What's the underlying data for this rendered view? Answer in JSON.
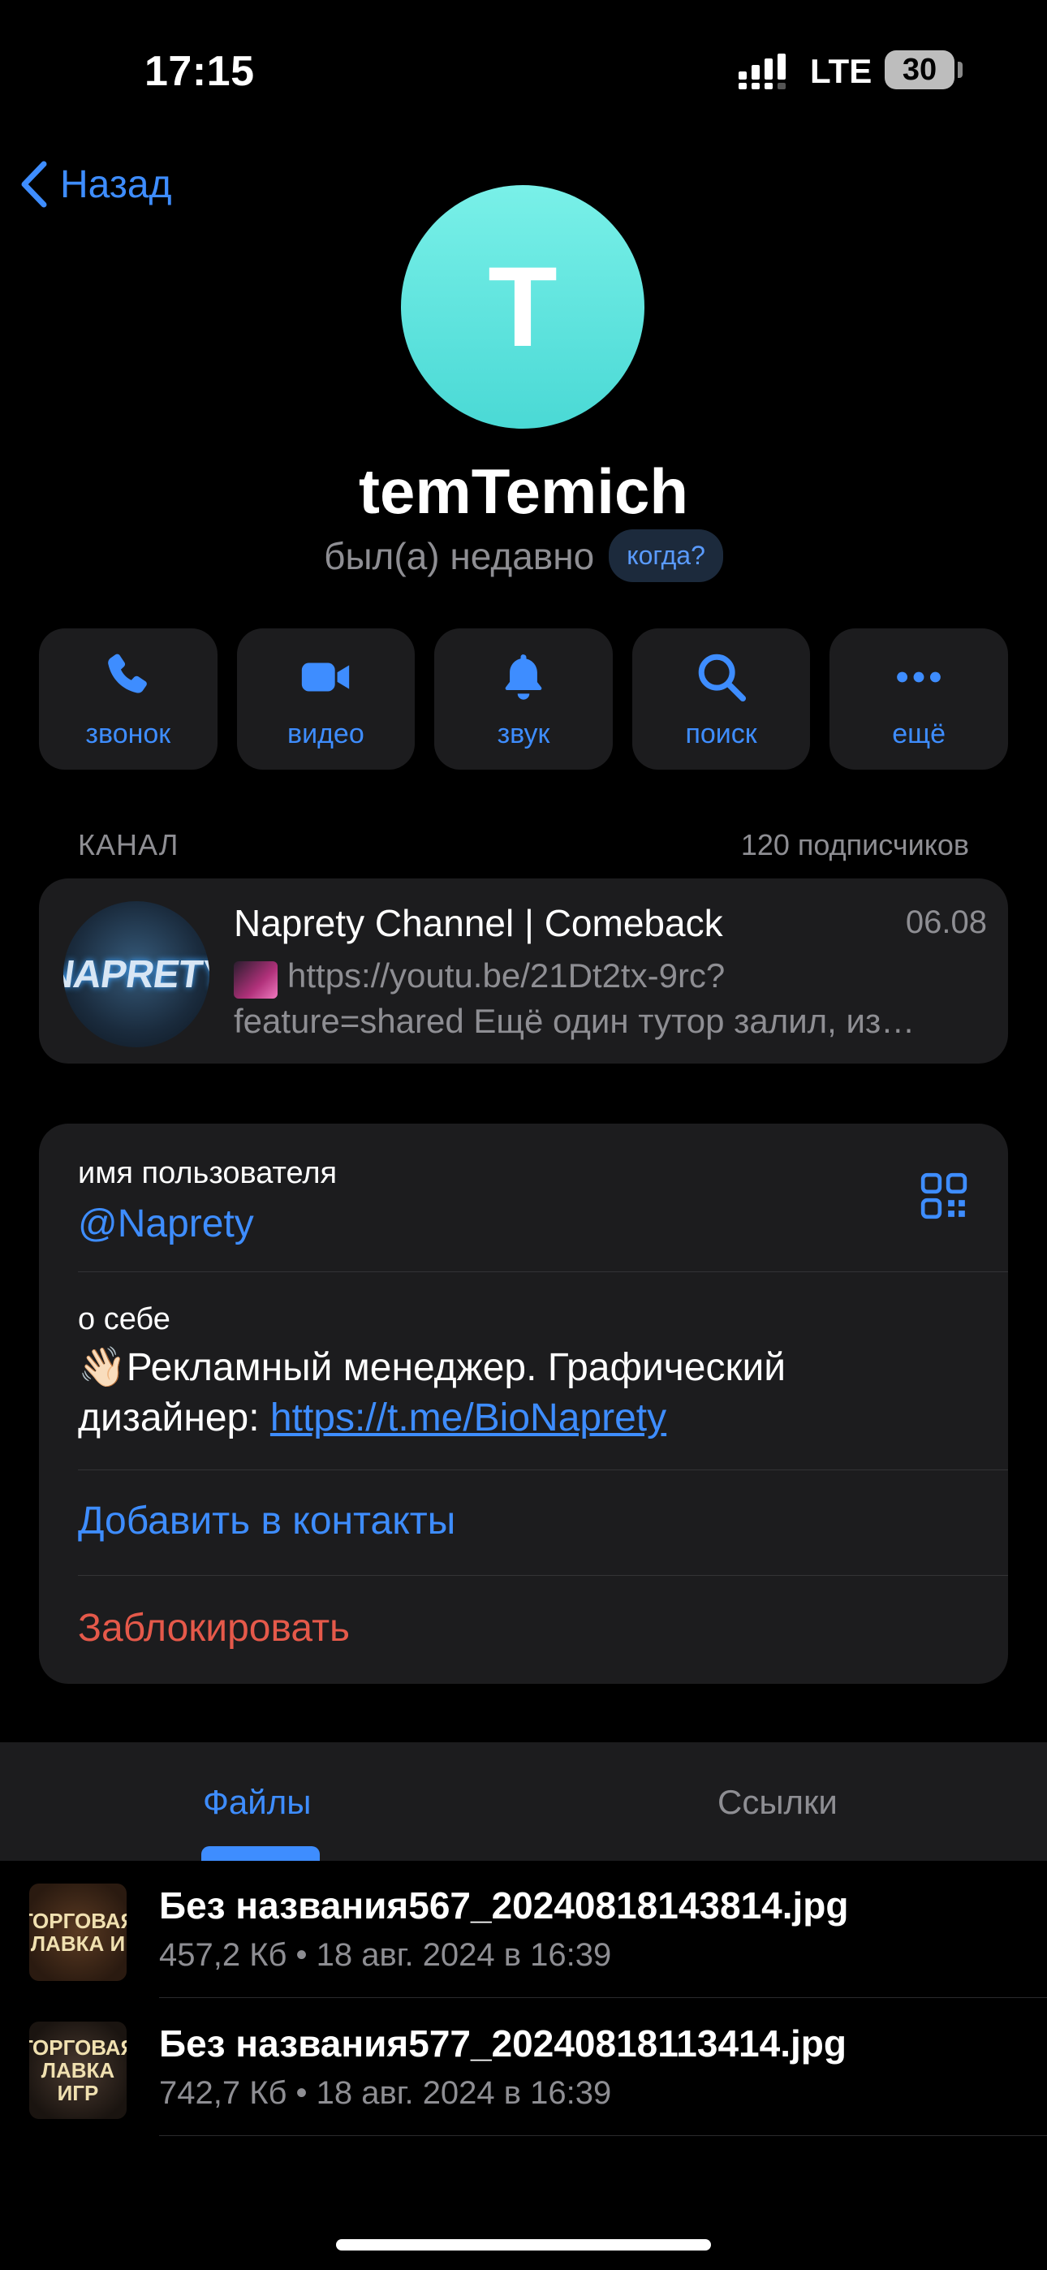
{
  "status_bar": {
    "time": "17:15",
    "network": "LTE",
    "battery": "30"
  },
  "nav": {
    "back_label": "Назад"
  },
  "profile": {
    "initial": "T",
    "name": "temTemich",
    "status": "был(а) недавно",
    "when_label": "когда?",
    "avatar_color": "#5ee3df"
  },
  "actions": [
    {
      "label": "звонок",
      "icon": "phone-icon"
    },
    {
      "label": "видео",
      "icon": "video-icon"
    },
    {
      "label": "звук",
      "icon": "bell-icon"
    },
    {
      "label": "поиск",
      "icon": "search-icon"
    },
    {
      "label": "ещё",
      "icon": "more-icon"
    }
  ],
  "channel": {
    "section_label": "КАНАЛ",
    "subscribers": "120 подписчиков",
    "avatar_text": "NAPRETY",
    "title": "Naprety Channel | Comeback",
    "date": "06.08",
    "preview_line1": "https://youtu.be/21Dt2tx-9rc?",
    "preview_line2": "feature=shared Ещё один тутор залил, из…"
  },
  "info": {
    "username_label": "имя пользователя",
    "username": "@Naprety",
    "about_label": "о себе",
    "about_text": "👋🏻Рекламный менеджер. Графический дизайнер: ",
    "about_link": "https://t.me/BioNaprety",
    "add_contact": "Добавить в контакты",
    "block": "Заблокировать"
  },
  "tabs": {
    "files": "Файлы",
    "links": "Ссылки",
    "active": "files"
  },
  "files": [
    {
      "name": "Без названия567_20240818143814.jpg",
      "meta": "457,2 Кб • 18 авг. 2024 в 16:39",
      "thumb_text": "ТОРГОВАЯ ЛАВКА И"
    },
    {
      "name": "Без названия577_20240818113414.jpg",
      "meta": "742,7 Кб • 18 авг. 2024 в 16:39",
      "thumb_text": "ТОРГОВАЯ ЛАВКА ИГР"
    }
  ],
  "colors": {
    "accent": "#3e8dff",
    "danger": "#e5594a",
    "card": "#1c1c1e",
    "muted": "#8e8e93"
  }
}
